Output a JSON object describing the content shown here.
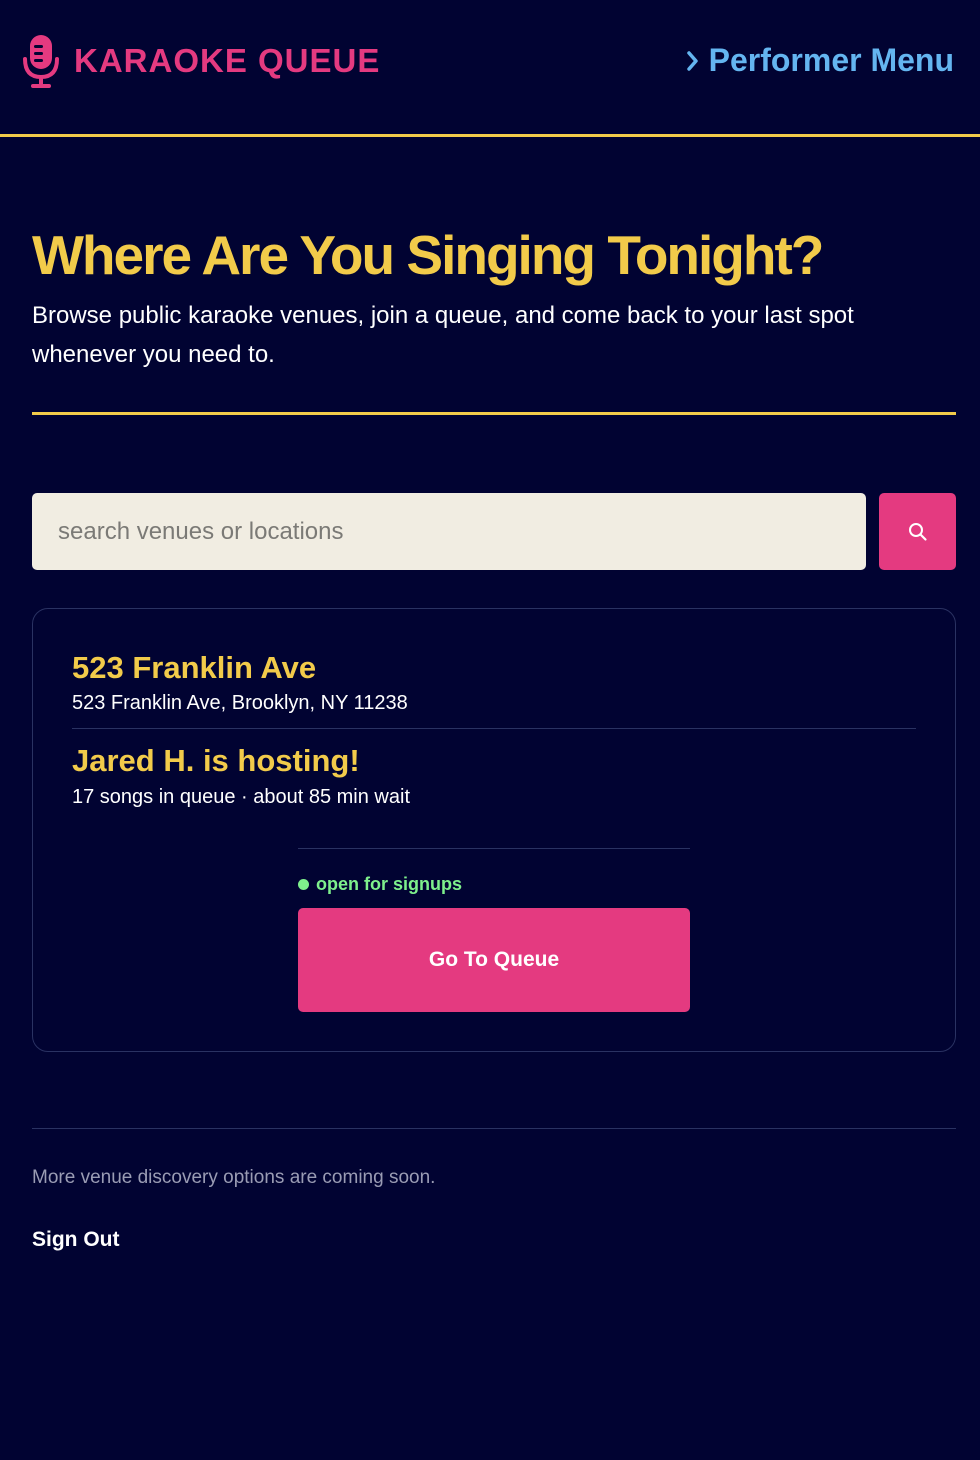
{
  "header": {
    "brand": "KARAOKE QUEUE",
    "brand_icon": "microphone-icon",
    "menu_label": "Performer Menu",
    "menu_icon": "chevron-right-icon"
  },
  "hero": {
    "title": "Where Are You Singing Tonight?",
    "subtitle": "Browse public karaoke venues, join a queue, and come back to your last spot whenever you need to."
  },
  "search": {
    "placeholder": "search venues or locations",
    "value": "",
    "button_icon": "search-icon"
  },
  "venue": {
    "name": "523 Franklin Ave",
    "address": "523 Franklin Ave, Brooklyn, NY 11238",
    "host": "Jared H. is hosting!",
    "queue_info": "17 songs in queue · about 85 min wait",
    "status": "open for signups",
    "button_label": "Go To Queue"
  },
  "footer": {
    "note": "More venue discovery options are coming soon.",
    "sign_out": "Sign Out"
  },
  "colors": {
    "background": "#010332",
    "accent_pink": "#e43a80",
    "accent_yellow": "#f2cb4a",
    "link_blue": "#64b5f0",
    "status_green": "#7ef08c"
  }
}
